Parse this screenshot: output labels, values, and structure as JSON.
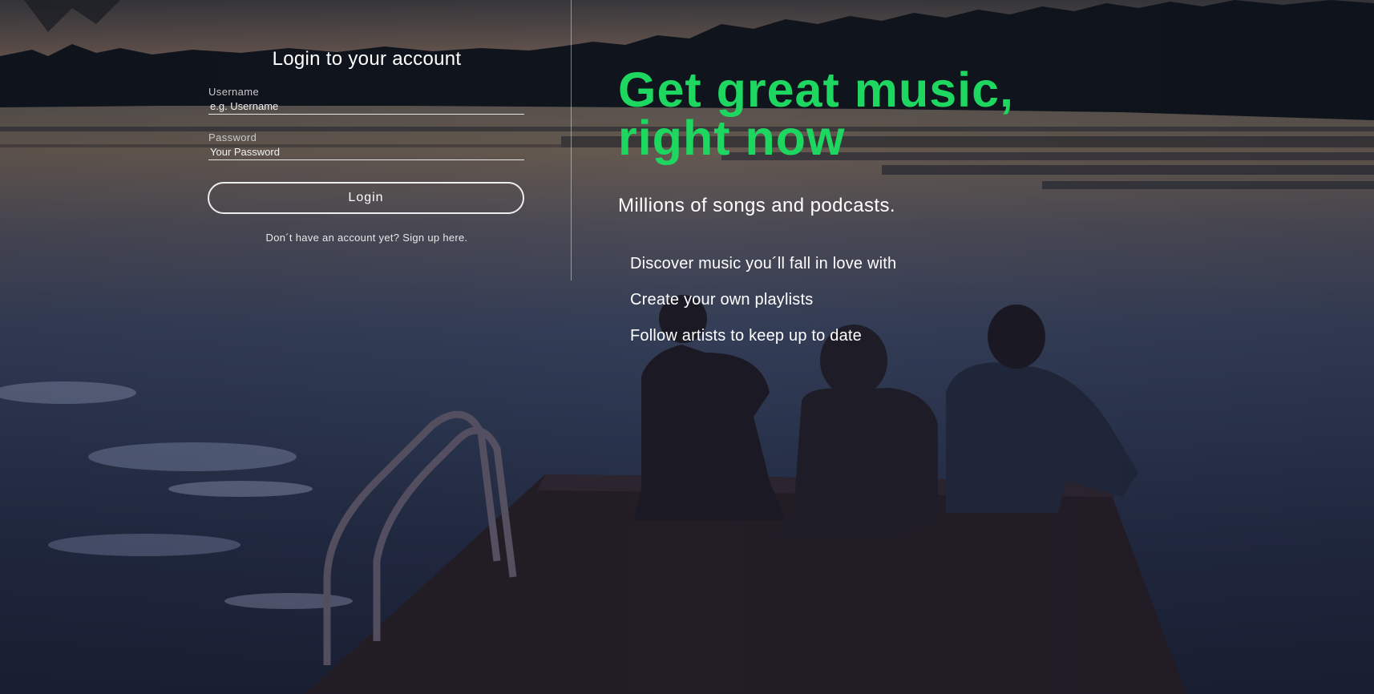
{
  "login": {
    "title": "Login to your account",
    "username_label": "Username",
    "username_placeholder": "e.g. Username",
    "password_label": "Password",
    "password_placeholder": "Your Password",
    "button_label": "Login",
    "signup_text": "Don´t have an account yet? Sign up here."
  },
  "hero": {
    "headline_line1": "Get great music,",
    "headline_line2": "right now",
    "subheadline": "Millions of songs and podcasts.",
    "features": [
      "Discover music you´ll fall in love with",
      "Create your own playlists",
      "Follow artists to keep up to date"
    ]
  },
  "colors": {
    "accent": "#1ed760",
    "text": "#ffffff"
  }
}
